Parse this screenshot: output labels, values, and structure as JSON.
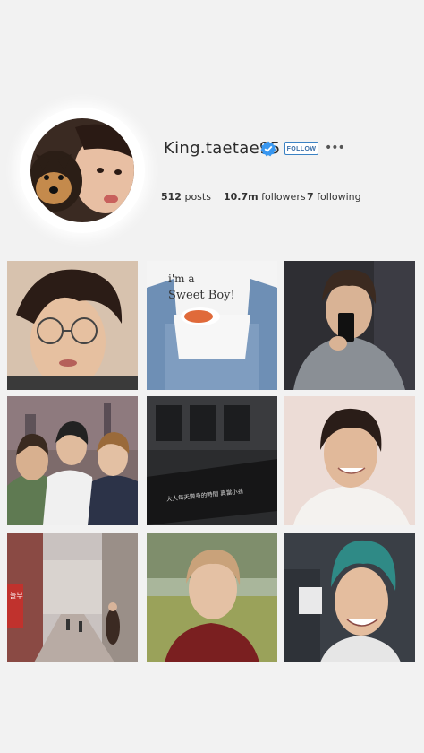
{
  "profile": {
    "username": "King.taetae95",
    "follow_label": "FOLLOW",
    "more_label": "•••",
    "stats": {
      "posts_count": "512",
      "posts_label": "posts",
      "followers_count": "10.7m",
      "followers_label": "followers",
      "following_count": "7",
      "following_label": "following"
    }
  },
  "grid": {
    "tiles": [
      {
        "icon": "photo-man-glasses"
      },
      {
        "icon": "photo-sweet-boy-shirt",
        "shirt_line1": "i'm a",
        "shirt_line2": "Sweet Boy!"
      },
      {
        "icon": "photo-mirror-selfie"
      },
      {
        "icon": "photo-group-three"
      },
      {
        "icon": "photo-building-sign",
        "sign_text": "大人每天變身的時間 真當小孩"
      },
      {
        "icon": "photo-smiling-man"
      },
      {
        "icon": "photo-street-scene",
        "sign_text": "놀부"
      },
      {
        "icon": "photo-field-portrait"
      },
      {
        "icon": "photo-teal-hair"
      }
    ]
  },
  "colors": {
    "background": "#f2f2f2",
    "follow_border": "#3b82c4",
    "verified_badge": "#3897f0"
  }
}
